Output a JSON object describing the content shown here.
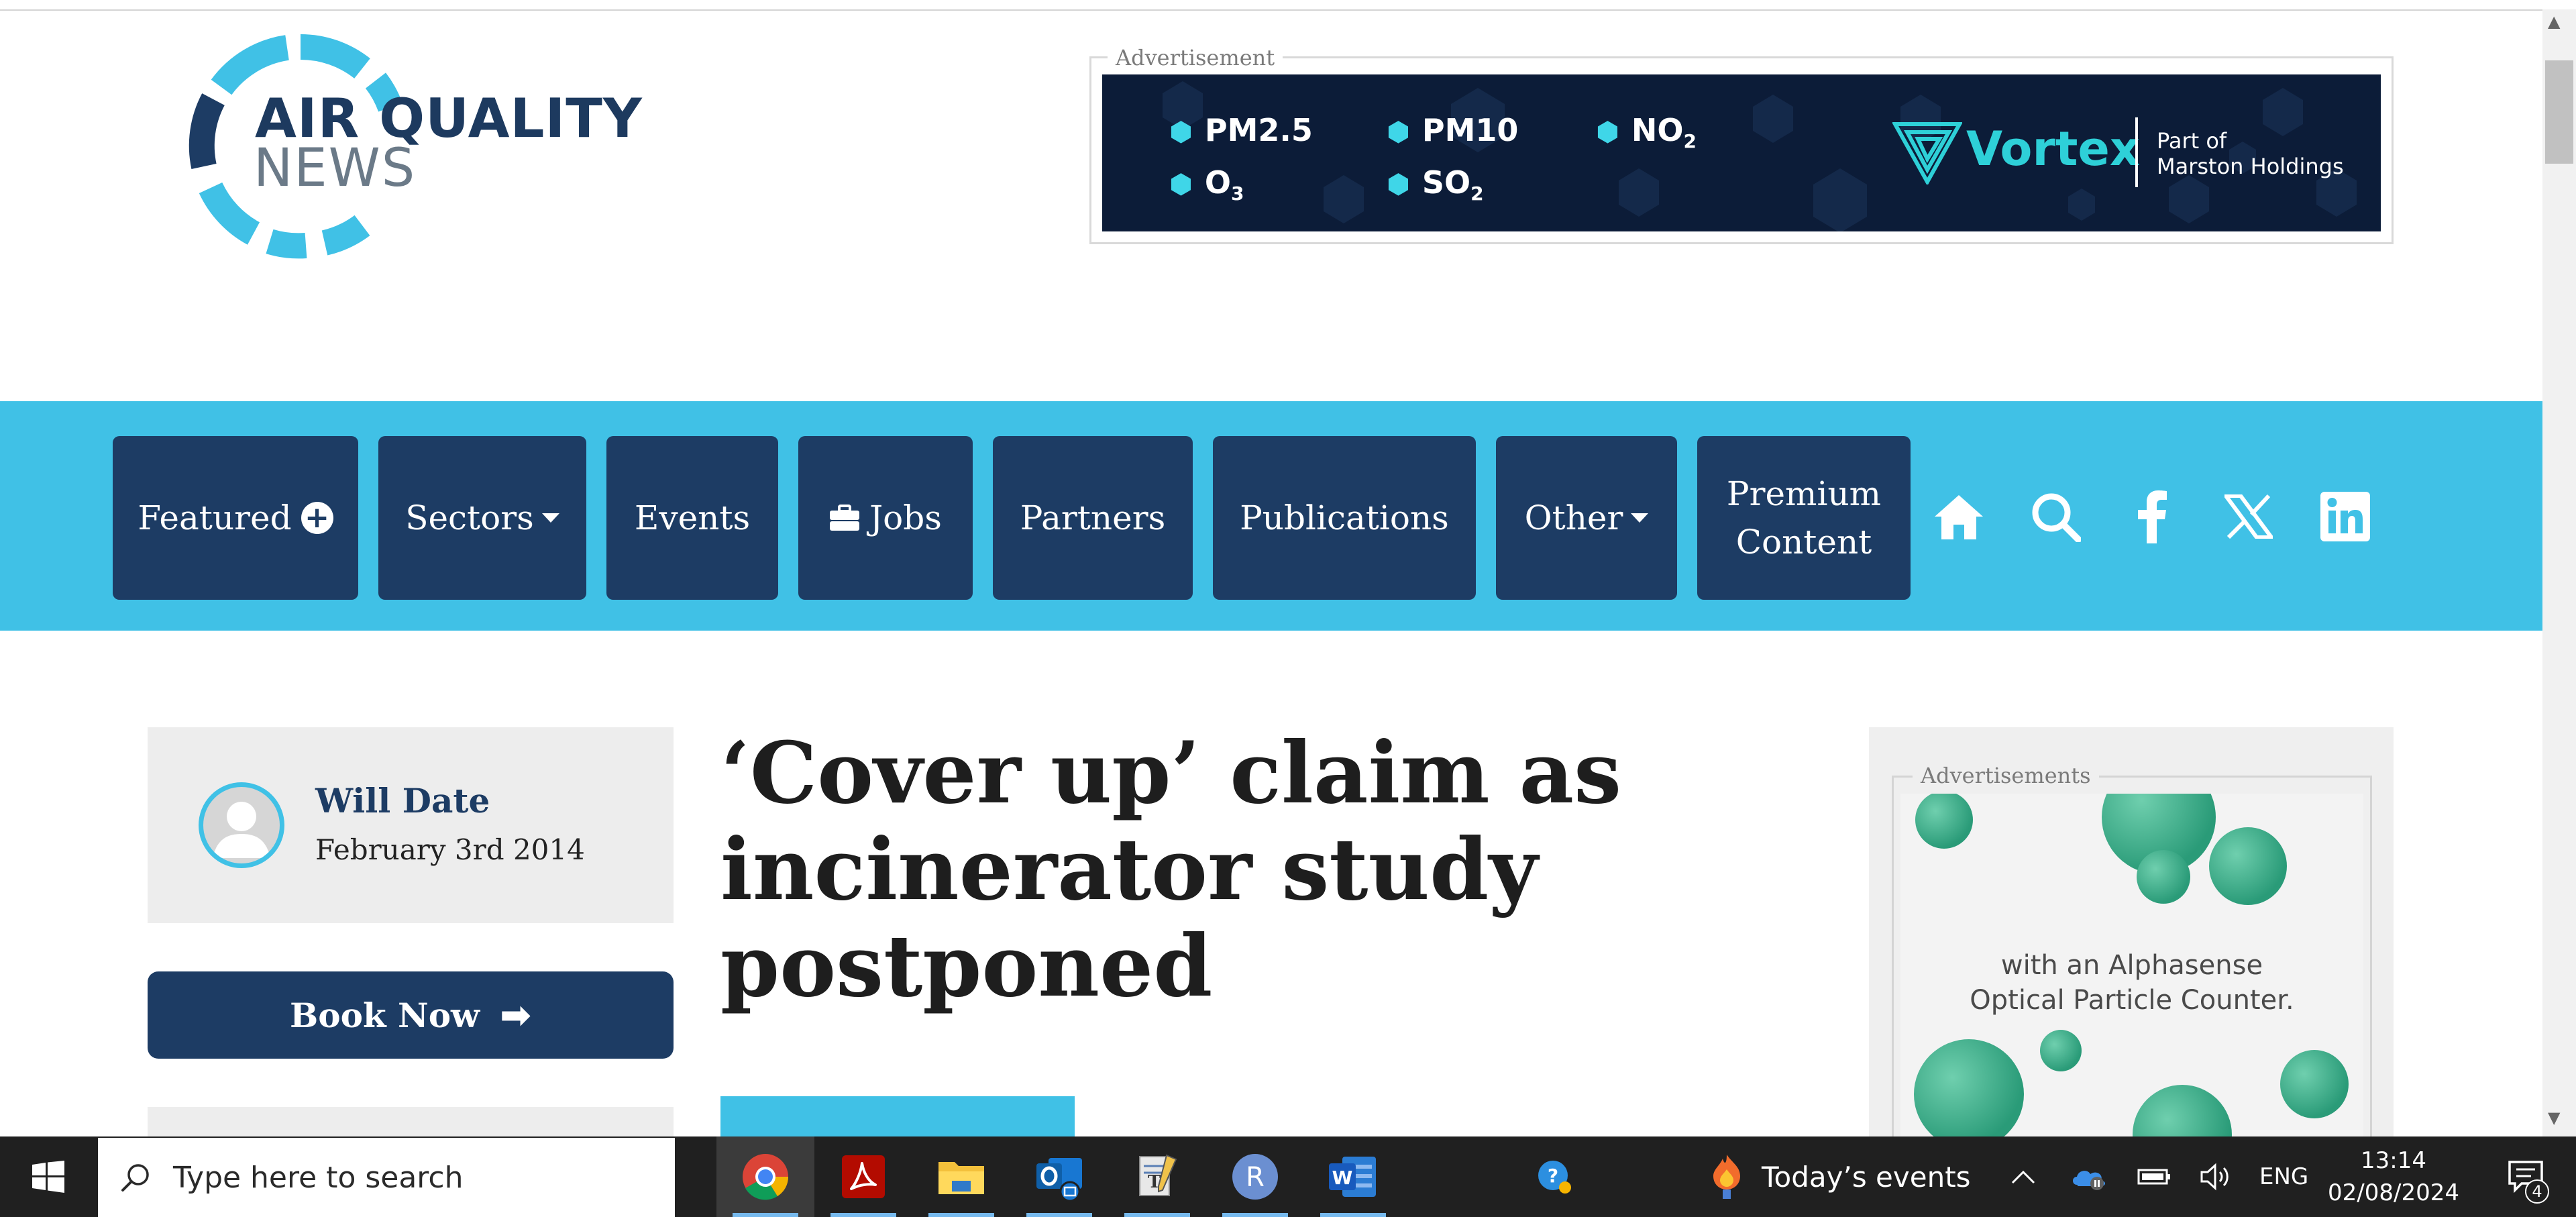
{
  "logo": {
    "line1": "AIR QUALITY",
    "line2": "NEWS"
  },
  "top_ad": {
    "label": "Advertisement",
    "pollutants": [
      {
        "name": "PM2.5",
        "sub": ""
      },
      {
        "name": "PM10",
        "sub": ""
      },
      {
        "name": "NO",
        "sub": "2"
      },
      {
        "name": "O",
        "sub": "3"
      },
      {
        "name": "SO",
        "sub": "2"
      }
    ],
    "brand": "Vortex",
    "brand_tagline_1": "Part of",
    "brand_tagline_2": "Marston Holdings"
  },
  "nav": {
    "featured": "Featured",
    "sectors": "Sectors",
    "events": "Events",
    "jobs": "Jobs",
    "partners": "Partners",
    "publications": "Publications",
    "other": "Other",
    "premium_line1": "Premium",
    "premium_line2": "Content",
    "icons": [
      "home-icon",
      "search-icon",
      "facebook-icon",
      "x-icon",
      "linkedin-icon"
    ]
  },
  "author": {
    "name": "Will Date",
    "date": "February 3rd 2014"
  },
  "book_now": {
    "label": "Book Now"
  },
  "article": {
    "headline": "‘Cover up’ claim as incinerator study postponed"
  },
  "side_ad": {
    "label": "Advertisements",
    "text_line1": "with an Alphasense",
    "text_line2": "Optical Particle Counter."
  },
  "taskbar": {
    "search_placeholder": "Type here to search",
    "apps": [
      "chrome-icon",
      "acrobat-icon",
      "file-explorer-icon",
      "outlook-icon",
      "notepad-icon",
      "r-icon",
      "word-icon"
    ],
    "today_events": "Today’s events",
    "language": "ENG",
    "time": "13:14",
    "date": "02/08/2024",
    "notification_count": "4"
  },
  "colors": {
    "brand_navy": "#1d3c64",
    "brand_cyan": "#40c1e6",
    "taskbar": "#202020"
  }
}
